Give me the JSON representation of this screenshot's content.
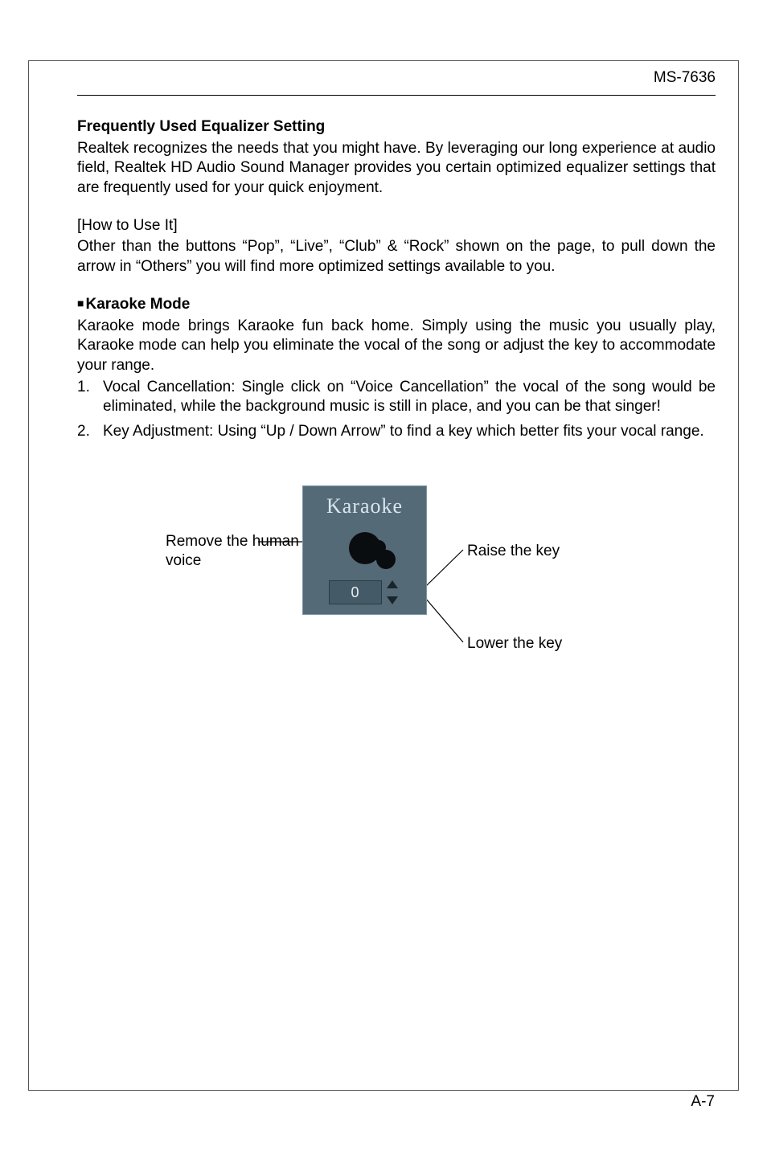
{
  "header": {
    "doc_id": "MS-7636"
  },
  "sections": {
    "eq": {
      "title": "Frequently Used Equalizer Setting",
      "desc": "Realtek recognizes the needs that you might have. By leveraging our long experience at audio field, Realtek HD Audio Sound Manager provides you certain optimized equalizer settings that are frequently used for your quick enjoyment.",
      "howto_label": "[How to Use It]",
      "howto_text": "Other than the buttons “Pop”, “Live”, “Club” & “Rock” shown on the page, to pull down the arrow in “Others” you will find more optimized settings available to you."
    },
    "karaoke": {
      "heading": "Karaoke Mode",
      "desc": "Karaoke mode brings Karaoke fun back home. Simply using the music you usually play, Karaoke mode can help you eliminate the vocal of the song or adjust the key to accommodate your range.",
      "items": [
        "Vocal Cancellation: Single click on “Voice Cancellation” the vocal of the song would be eliminated, while the background music is still in place, and you can be that singer!",
        "Key Adjustment: Using “Up / Down Arrow” to find a key which better fits your vocal range."
      ]
    }
  },
  "figure": {
    "panel_title": "Karaoke",
    "key_value": "0",
    "callouts": {
      "remove_voice": "Remove the human voice",
      "raise_key": "Raise the key",
      "lower_key": "Lower the key"
    }
  },
  "page_number": "A-7"
}
